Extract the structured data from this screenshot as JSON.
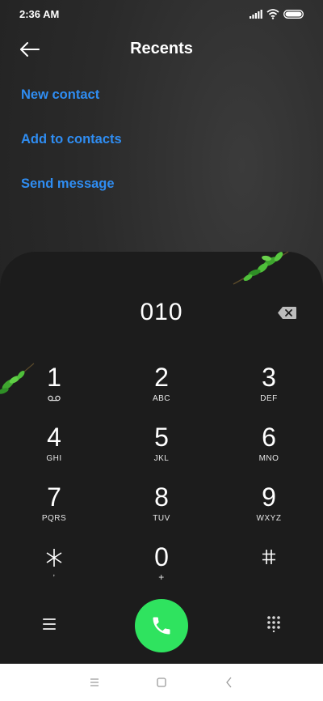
{
  "status_bar": {
    "time": "2:36 AM",
    "icons": [
      "signal-icon",
      "wifi-icon",
      "battery-icon"
    ]
  },
  "header": {
    "title": "Recents",
    "back_icon": "arrow-left-icon"
  },
  "menu": {
    "items": [
      "New contact",
      "Add to contacts",
      "Send message"
    ]
  },
  "dialer": {
    "number": "010",
    "keys": [
      {
        "digit": "1",
        "letters": "",
        "icon": "voicemail-icon"
      },
      {
        "digit": "2",
        "letters": "ABC"
      },
      {
        "digit": "3",
        "letters": "DEF"
      },
      {
        "digit": "4",
        "letters": "GHI"
      },
      {
        "digit": "5",
        "letters": "JKL"
      },
      {
        "digit": "6",
        "letters": "MNO"
      },
      {
        "digit": "7",
        "letters": "PQRS"
      },
      {
        "digit": "8",
        "letters": "TUV"
      },
      {
        "digit": "9",
        "letters": "WXYZ"
      },
      {
        "digit": "*",
        "letters": ","
      },
      {
        "digit": "0",
        "letters": "+"
      },
      {
        "digit": "#",
        "letters": ""
      }
    ]
  },
  "colors": {
    "accent_link": "#2f8df2",
    "call_button": "#2fe35f",
    "dialer_bg": "#1c1c1c"
  }
}
